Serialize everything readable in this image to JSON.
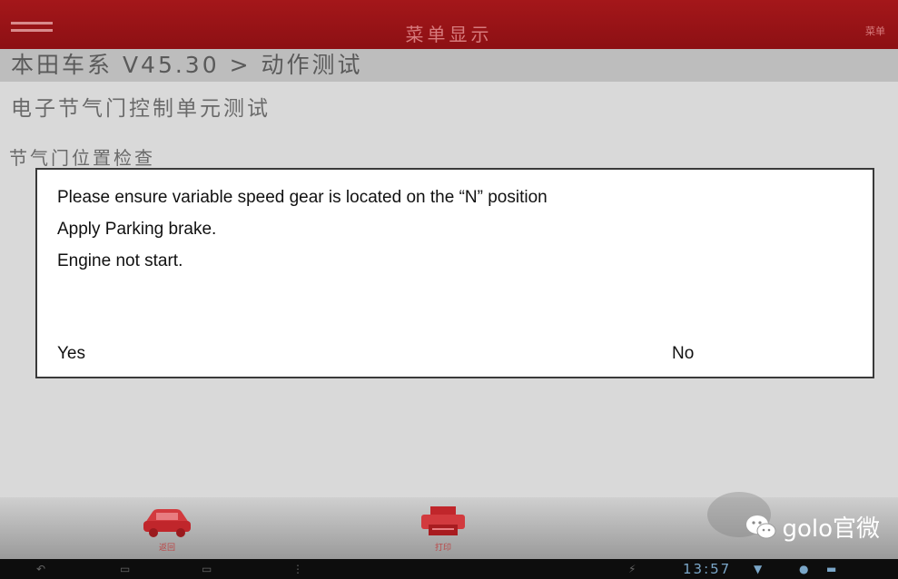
{
  "topbar": {
    "title": "菜单显示",
    "right_label": "菜单",
    "menu_icon": "hamburger-icon"
  },
  "breadcrumb": "本田车系 V45.30 > 动作测试",
  "subtitle": "电子节气门控制单元测试",
  "subtitle2": "节气门位置检查",
  "dialog": {
    "lines": [
      "Please ensure variable speed gear is located on the “N” position",
      "Apply Parking brake.",
      "Engine not start."
    ],
    "yes_label": "Yes",
    "no_label": "No"
  },
  "bottombar": {
    "tools": [
      {
        "label": "返回",
        "icon": "car-icon"
      },
      {
        "label": "打印",
        "icon": "printer-icon"
      }
    ],
    "watermark": "golo官微"
  },
  "navbar": {
    "time": "13:57"
  },
  "colors": {
    "brand_red": "#a4171a",
    "background": "#d9d9d9"
  }
}
